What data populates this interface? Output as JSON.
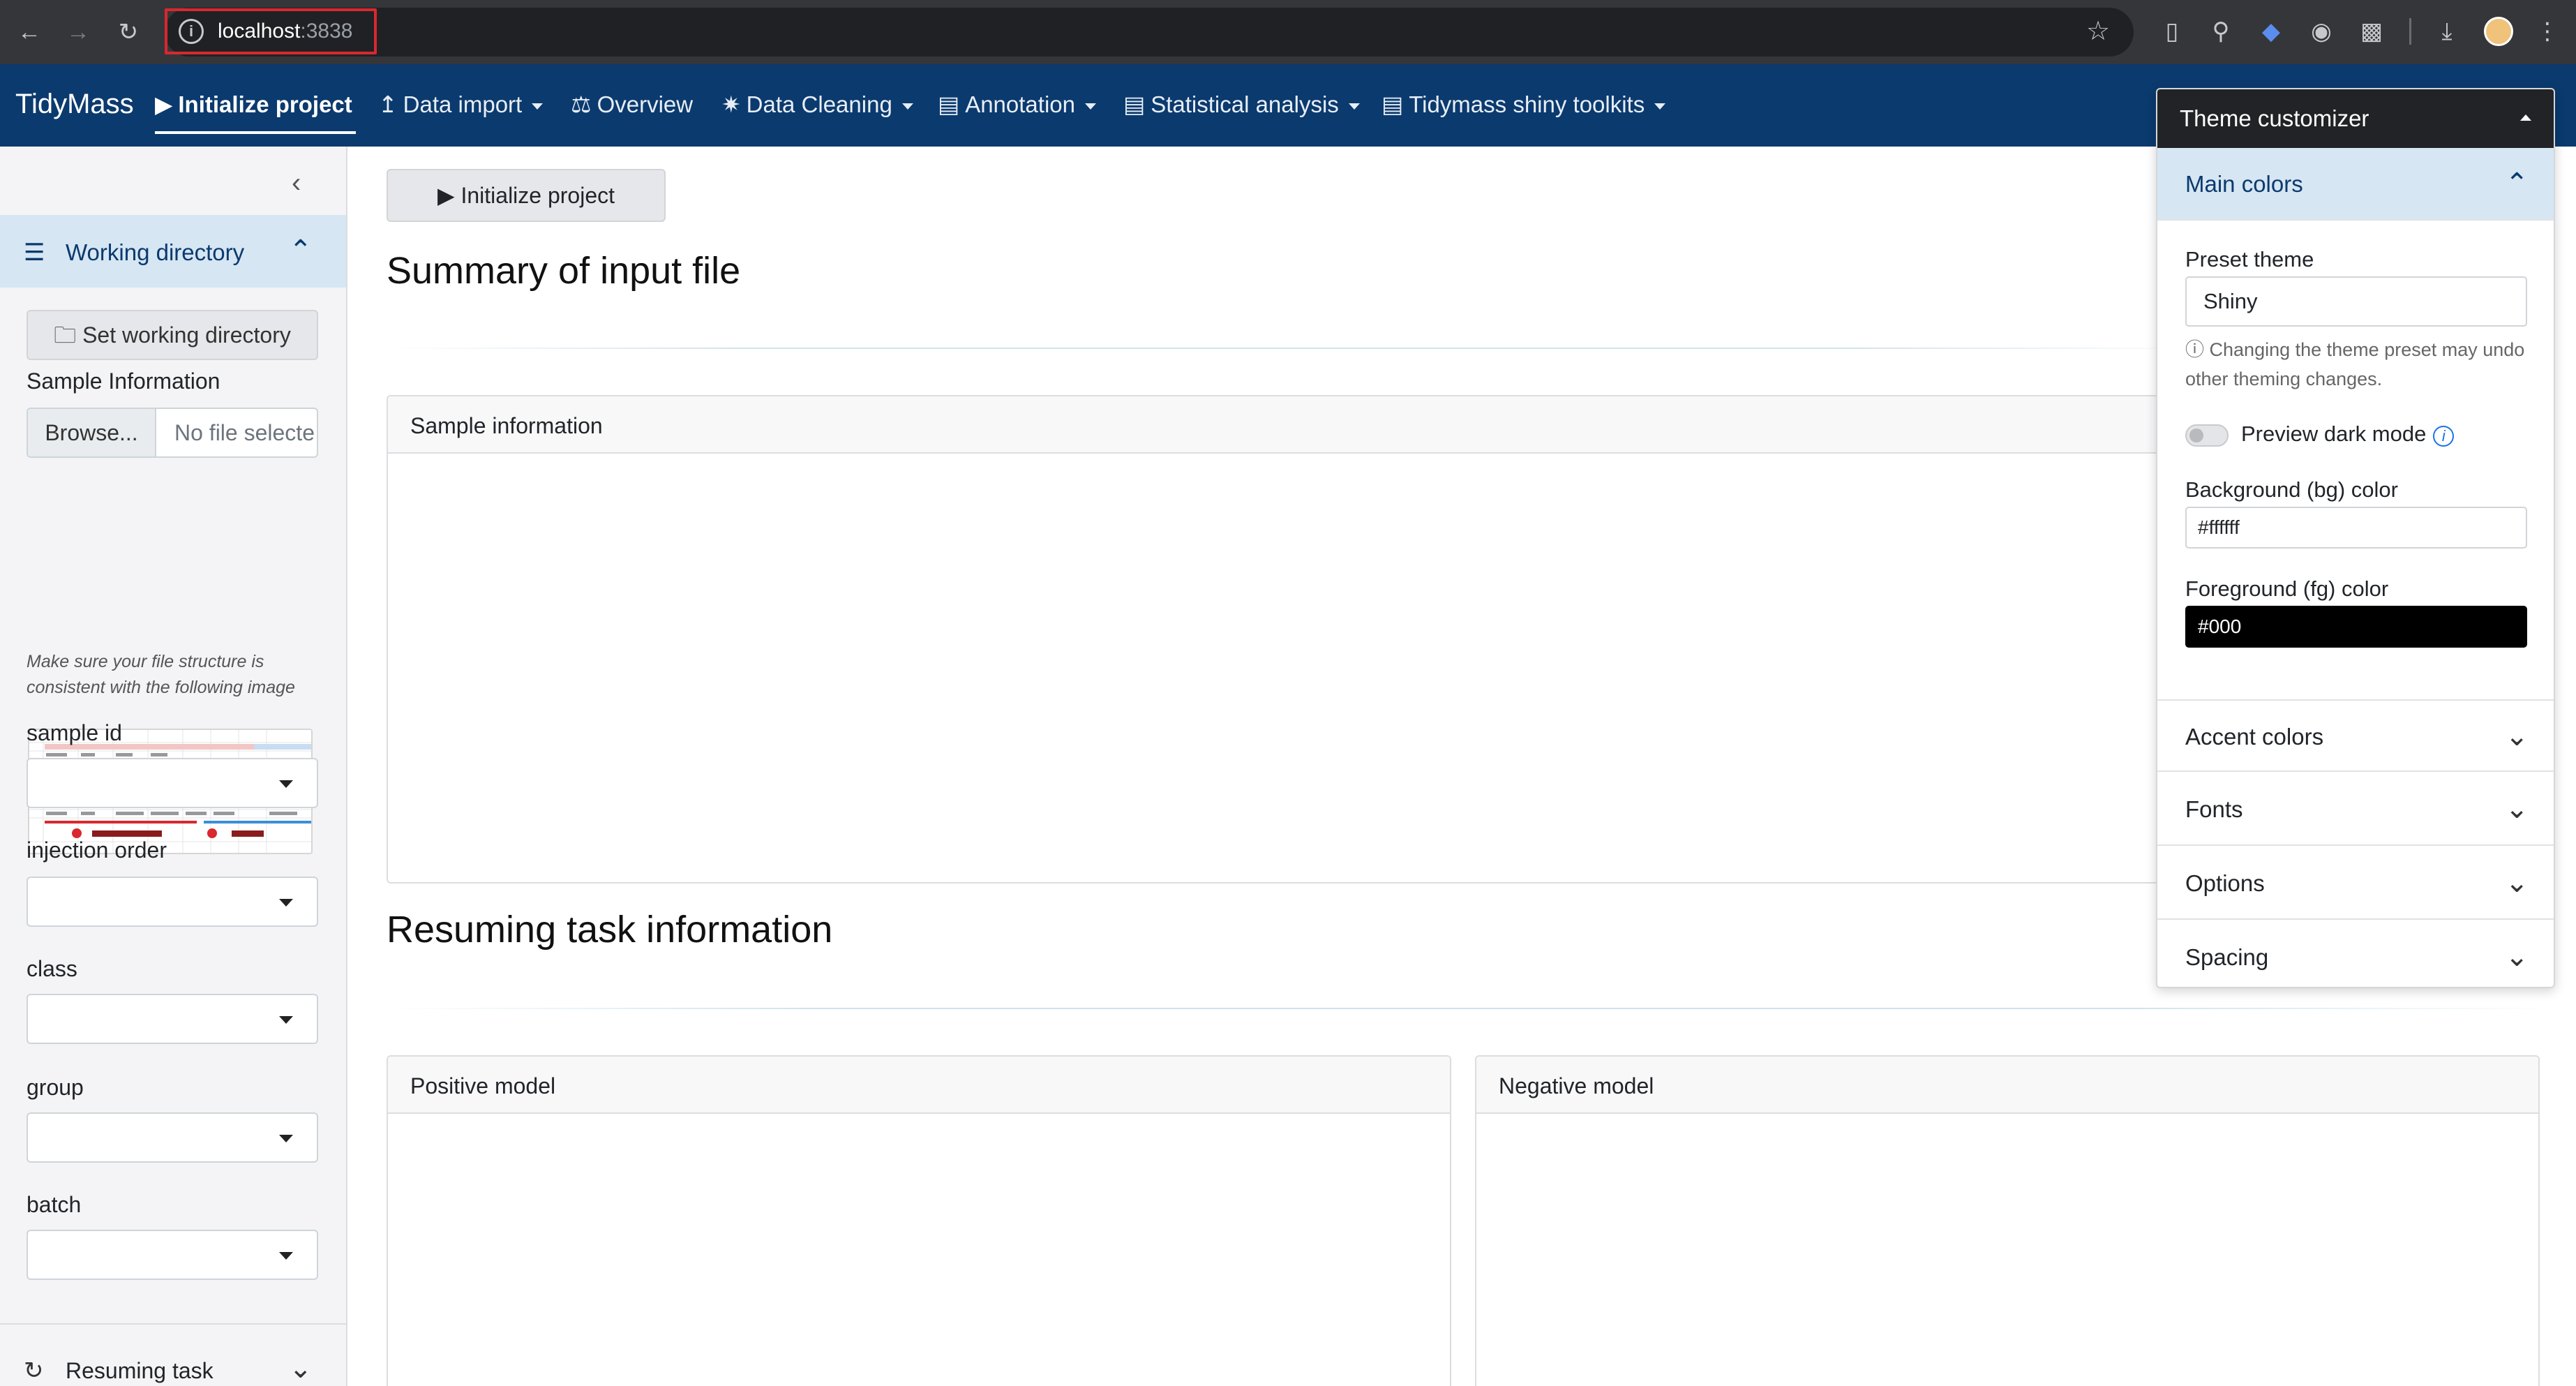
{
  "browser": {
    "url_host": "localhost",
    "url_port": ":3838"
  },
  "navbar": {
    "brand": "TidyMass",
    "items": [
      {
        "label": "Initialize project"
      },
      {
        "label": "Data import"
      },
      {
        "label": "Overview"
      },
      {
        "label": "Data Cleaning"
      },
      {
        "label": "Annotation"
      },
      {
        "label": "Statistical analysis"
      },
      {
        "label": "Tidymass shiny toolkits"
      }
    ]
  },
  "sidebar": {
    "section_title": "Working directory",
    "set_wd_button": "Set working directory",
    "sample_info_label": "Sample Information",
    "browse_button": "Browse...",
    "file_placeholder": "No file selected",
    "hint": "Make sure your file structure is consistent with the following image",
    "selects": [
      {
        "label": "sample id"
      },
      {
        "label": "injection order"
      },
      {
        "label": "class"
      },
      {
        "label": "group"
      },
      {
        "label": "batch"
      }
    ],
    "resume_section": "Resuming task"
  },
  "main": {
    "init_button": "Initialize project",
    "summary_title": "Summary of input file",
    "sample_card": "Sample information",
    "resume_title": "Resuming task information",
    "positive_card": "Positive model",
    "negative_card": "Negative model"
  },
  "theme_customizer": {
    "title": "Theme customizer",
    "main_colors": "Main colors",
    "preset_label": "Preset theme",
    "preset_value": "Shiny",
    "preset_note": "Changing the theme preset may undo other theming changes.",
    "dark_mode_label": "Preview dark mode",
    "dark_mode_on": false,
    "bg_label": "Background (bg) color",
    "bg_value": "#ffffff",
    "fg_label": "Foreground (fg) color",
    "fg_value": "#000",
    "sections": [
      "Accent colors",
      "Fonts",
      "Options",
      "Spacing"
    ]
  },
  "colors": {
    "navbar_bg": "#0b3a6e",
    "accent_light": "#d6e6f3",
    "customizer_header": "#222326"
  }
}
